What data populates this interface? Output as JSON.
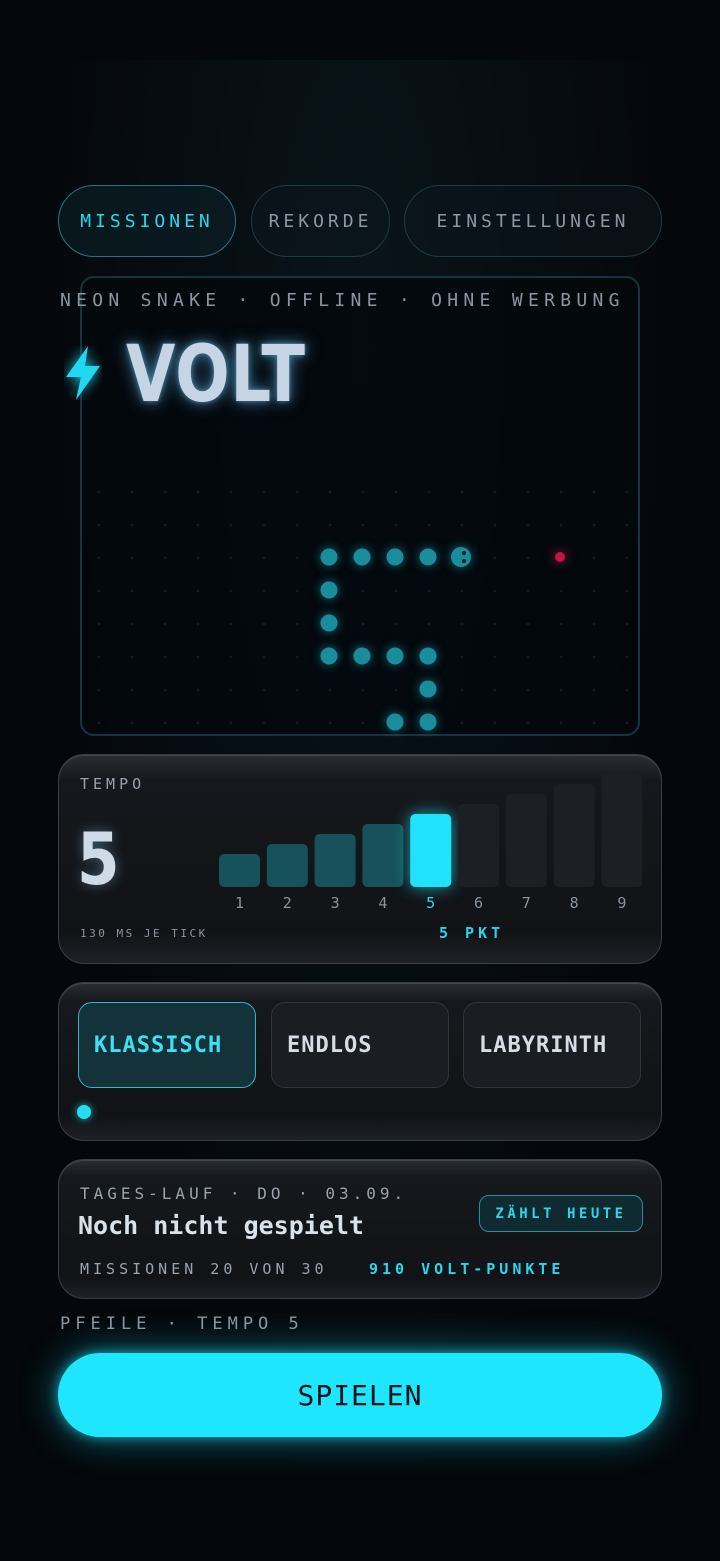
{
  "nav": {
    "tabs": [
      {
        "label": "MISSIONEN",
        "active": true
      },
      {
        "label": "REKORDE",
        "active": false
      },
      {
        "label": "EINSTELLUNGEN",
        "active": false
      }
    ]
  },
  "hero": {
    "kicker": "NEON SNAKE · OFFLINE · OHNE WERBUNG",
    "title": "VOLT",
    "icon": "lightning-bolt-icon"
  },
  "tempo": {
    "label": "TEMPO",
    "value": "5",
    "levels": [
      "1",
      "2",
      "3",
      "4",
      "5",
      "6",
      "7",
      "8",
      "9"
    ],
    "selected_level": 5,
    "ms_per_tick": "130 MS JE TICK",
    "points": "5 PKT"
  },
  "modes": {
    "items": [
      {
        "label": "KLASSISCH",
        "active": true
      },
      {
        "label": "ENDLOS",
        "active": false
      },
      {
        "label": "LABYRINTH",
        "active": false
      }
    ]
  },
  "daily": {
    "kicker": "TAGES-LAUF · DO · 03.09.",
    "status": "Noch nicht gespielt",
    "badge": "ZÄHLT HEUTE",
    "missions": "MISSIONEN 20 VON 30",
    "points": "910 VOLT-PUNKTE"
  },
  "footer": {
    "hint": "PFEILE · TEMPO 5",
    "play_label": "SPIELEN"
  },
  "colors": {
    "accent": "#1fe6ff",
    "snake": "#1a8d9c",
    "food": "#c0144a",
    "background": "#04070b"
  }
}
